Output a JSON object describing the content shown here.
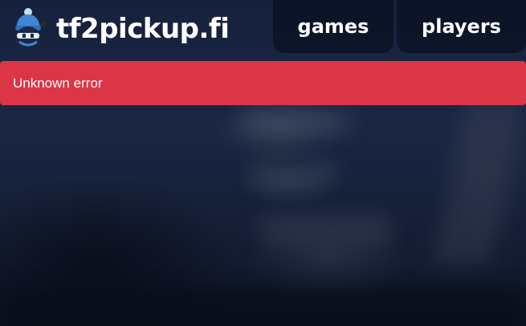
{
  "header": {
    "site_name": "tf2pickup.fi",
    "logo_icon": "mascot-beanie-icon",
    "nav": [
      {
        "label": "games"
      },
      {
        "label": "players"
      }
    ]
  },
  "alert": {
    "message": "Unknown error",
    "color": "#dc3545"
  },
  "colors": {
    "background": "#16223d",
    "text": "#ffffff"
  }
}
